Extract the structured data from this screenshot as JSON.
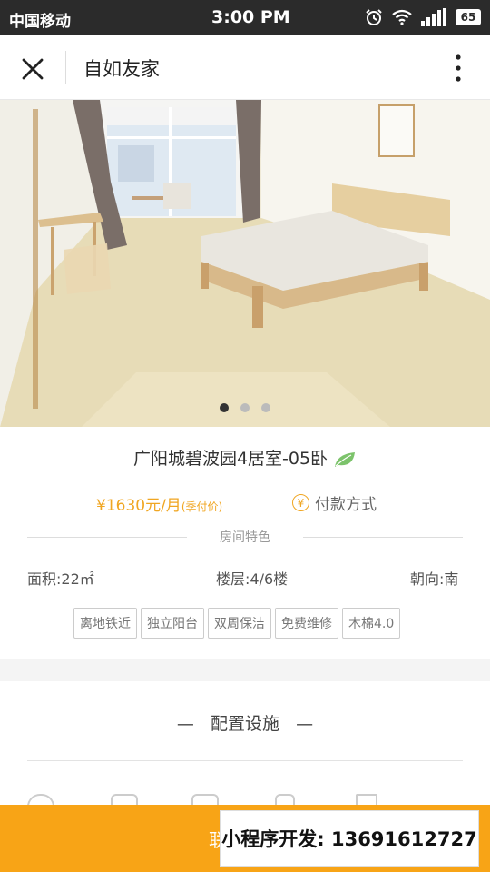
{
  "status_bar": {
    "carrier": "中国移动",
    "time": "3:00 PM",
    "battery": "65",
    "icons": [
      "alarm-icon",
      "wifi-icon",
      "signal-icon",
      "battery-icon"
    ]
  },
  "nav": {
    "title": "自如友家",
    "icons": [
      "close-icon",
      "more-vertical-icon"
    ]
  },
  "gallery": {
    "image": "room-photo",
    "slide_count": 3,
    "active_slide": 1
  },
  "room": {
    "title": "广阳城碧波园4居室-05卧",
    "badge_icon": "leaf-icon",
    "price": "¥1630元/月",
    "price_note": "(季付价)",
    "payment_label": "付款方式"
  },
  "features": {
    "heading": "房间特色",
    "area": "面积:22㎡",
    "floor": "楼层:4/6楼",
    "orientation": "朝向:南",
    "tags": [
      "离地铁近",
      "独立阳台",
      "双周保洁",
      "免费维修",
      "木棉4.0"
    ]
  },
  "config": {
    "title": "配置设施"
  },
  "bottom": {
    "contact_partial": "联",
    "promo": "小程序开发: 13691612727"
  },
  "colors": {
    "accent": "#f8a416",
    "price": "#f0a622",
    "leaf": "#7cc36b",
    "status_bar": "#2b2b2b"
  }
}
